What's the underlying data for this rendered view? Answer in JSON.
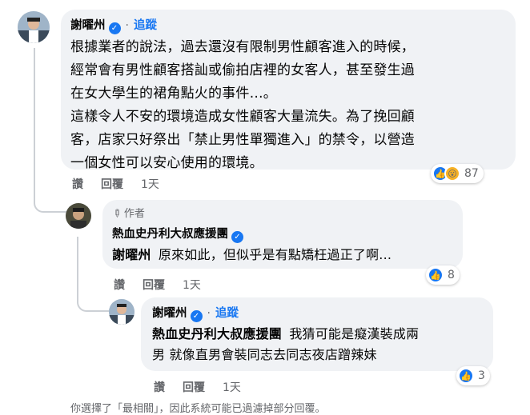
{
  "comments": [
    {
      "name": "謝曜州",
      "follow": "追蹤",
      "lines": [
        "根據業者的說法，過去還沒有限制男性顧客進入的時候，",
        "經常會有男性顧客搭訕或偷拍店裡的女客人，甚至發生過",
        "在女大學生的裙角點火的事件…。",
        "這樣令人不安的環境造成女性顧客大量流失。為了挽回顧",
        "客，店家只好祭出「禁止男性單獨進入」的禁令，以營造",
        "一個女性可以安心使用的環境。"
      ],
      "actions": {
        "like": "讚",
        "reply": "回覆",
        "time": "1天"
      },
      "reaction_count": "87"
    },
    {
      "author_badge": "作者",
      "name": "熱血史丹利大叔應援團",
      "mention": "謝曜州",
      "text": "原來如此，但似乎是有點矯枉過正了啊...",
      "actions": {
        "like": "讚",
        "reply": "回覆",
        "time": "1天"
      },
      "reaction_count": "8"
    },
    {
      "name": "謝曜州",
      "follow": "追蹤",
      "mention": "熱血史丹利大叔應援團",
      "text_line1": "我猜可能是癡漢裝成兩",
      "text_line2": "男 就像直男會裝同志去同志夜店蹭辣妹",
      "actions": {
        "like": "讚",
        "reply": "回覆",
        "time": "1天"
      },
      "reaction_count": "3"
    }
  ],
  "footer_note": "你選擇了「最相關」，因此系統可能已過濾掉部分回覆。",
  "colors": {
    "link": "#1877f2",
    "bubble": "#f0f2f5",
    "meta": "#65676b"
  }
}
